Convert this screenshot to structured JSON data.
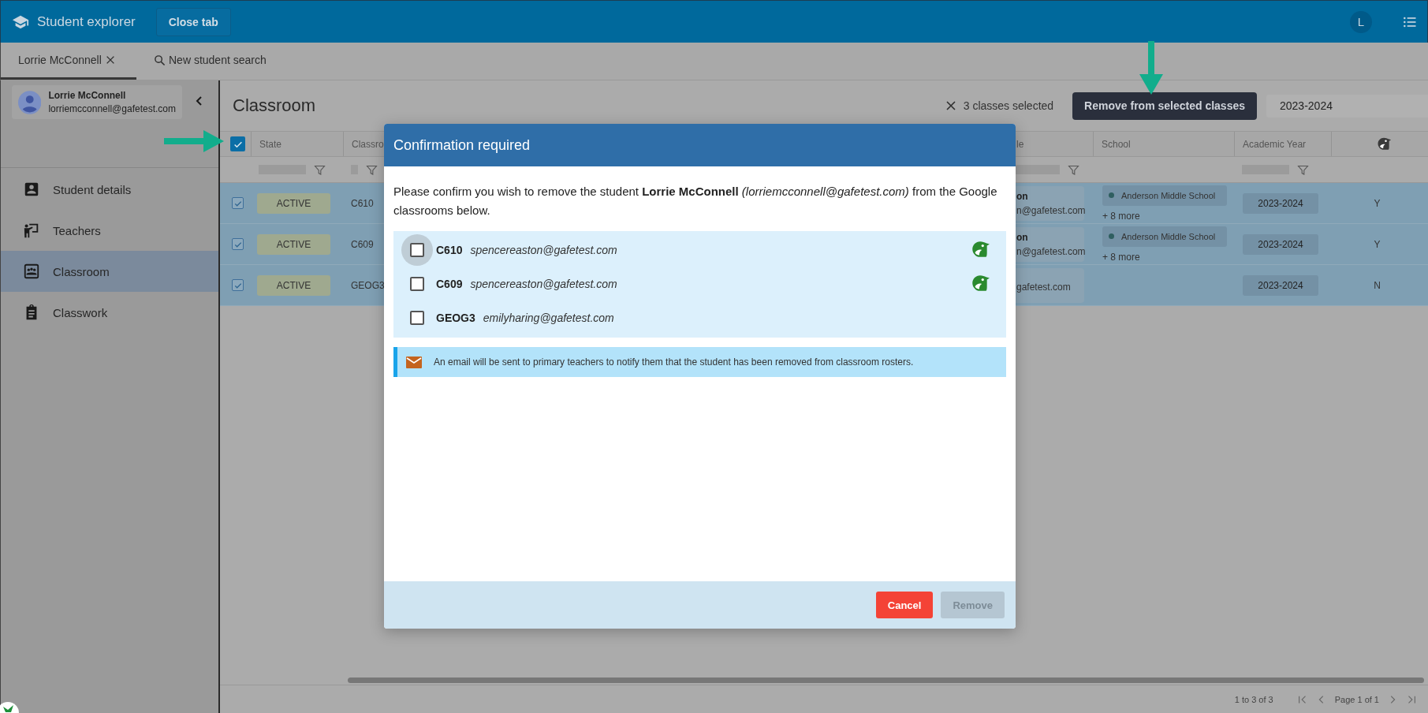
{
  "header": {
    "title": "Student explorer",
    "close_button": "Close tab",
    "avatar": "L"
  },
  "tabs": [
    {
      "label": "Lorrie McConnell",
      "kind": "student",
      "selected": true
    },
    {
      "label": "New student search",
      "kind": "search",
      "selected": false
    }
  ],
  "sidebar": {
    "student": {
      "name": "Lorrie McConnell",
      "email": "lorriemcconnell@gafetest.com"
    },
    "items": [
      {
        "label": "Student details",
        "selected": false
      },
      {
        "label": "Teachers",
        "selected": false
      },
      {
        "label": "Classroom",
        "selected": true
      },
      {
        "label": "Classwork",
        "selected": false
      }
    ]
  },
  "main": {
    "title": "Classroom",
    "selection": "3 classes selected",
    "action_button": "Remove from selected classes",
    "year": "2023-2024"
  },
  "table": {
    "select_all_checked": true,
    "columns": [
      {
        "kind": "text",
        "label": "State",
        "filter": true
      },
      {
        "kind": "text",
        "label": "Classro",
        "filter": true
      },
      {
        "kind": "text",
        "label": "le",
        "filter": true
      },
      {
        "kind": "text",
        "label": "School",
        "filter": false
      },
      {
        "kind": "text",
        "label": "Academic Year",
        "filter": true
      },
      {
        "kind": "icon",
        "filter": false
      }
    ],
    "rows": [
      {
        "checked": true,
        "state": "ACTIVE",
        "classroom": "C610",
        "teacher_name": "on",
        "teacher_email": "n@gafetest.com",
        "school": "Anderson Middle School",
        "school_more": "+ 8 more",
        "year": "2023-2024",
        "column_6": "Y"
      },
      {
        "checked": true,
        "state": "ACTIVE",
        "classroom": "C609",
        "teacher_name": "on",
        "teacher_email": "n@gafetest.com",
        "school": "Anderson Middle School",
        "school_more": "+ 8 more",
        "year": "2023-2024",
        "column_6": "Y"
      },
      {
        "checked": true,
        "state": "ACTIVE",
        "classroom": "GEOG3",
        "teacher_email": "gafetest.com",
        "year": "2023-2024",
        "column_6": "N"
      }
    ]
  },
  "pagination": {
    "summary": "1 to 3 of 3",
    "page": "Page 1 of 1"
  },
  "dialog": {
    "title": "Confirmation required",
    "message": "Please confirm you wish to remove the student **Lorrie McConnell** *(lorriemcconnell@gafetest.com)* from the Google classrooms below.",
    "classes": [
      {
        "code": "C610",
        "teacher": "spencereaston@gafetest.com",
        "checked": false,
        "focused": true,
        "synced": true
      },
      {
        "code": "C609",
        "teacher": "spencereaston@gafetest.com",
        "checked": false,
        "focused": false,
        "synced": true
      },
      {
        "code": "GEOG3",
        "teacher": "emilyharing@gafetest.com",
        "checked": false,
        "focused": false,
        "synced": false
      }
    ],
    "notice": "An email will be sent to primary teachers to notify them that the student has been removed from classroom rosters.",
    "buttons": [
      {
        "label": "Cancel",
        "kind": "danger",
        "disabled": false
      },
      {
        "label": "Remove",
        "kind": "primary",
        "disabled": true
      }
    ]
  }
}
